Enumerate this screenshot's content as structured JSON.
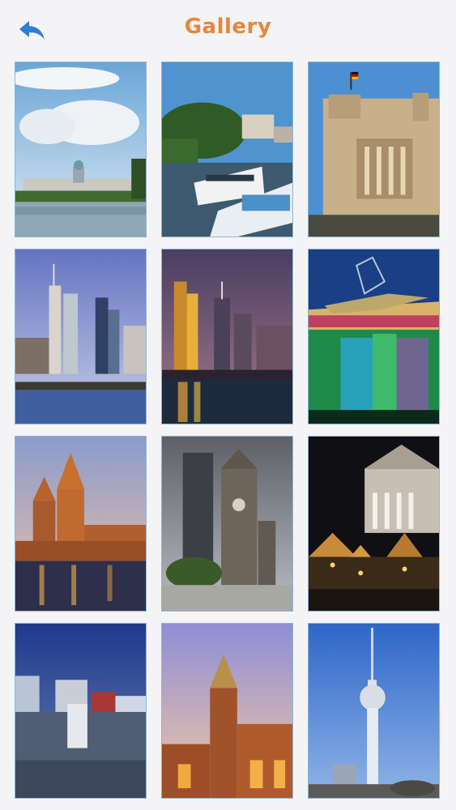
{
  "header": {
    "title": "Gallery",
    "back_icon": "back-arrow-icon",
    "title_color": "#e8863a",
    "icon_color": "#2f7fd1"
  },
  "gallery": {
    "photo_count": 12,
    "columns": 3
  }
}
